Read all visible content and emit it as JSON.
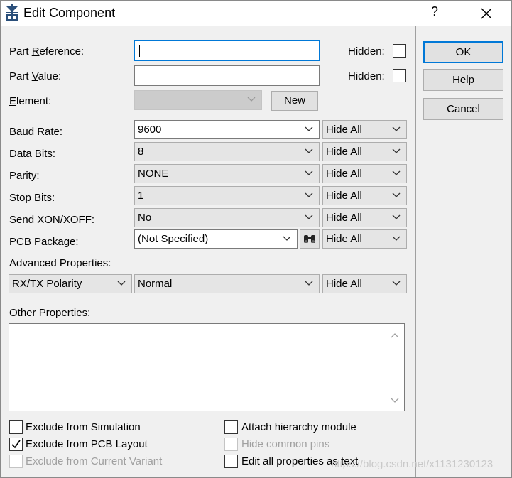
{
  "window": {
    "title": "Edit Component",
    "help_glyph": "?"
  },
  "fields": {
    "part_reference": {
      "label_pre": "Part ",
      "label_u": "R",
      "label_post": "eference:",
      "value": "",
      "hidden_label": "Hidden:"
    },
    "part_value": {
      "label_pre": "Part ",
      "label_u": "V",
      "label_post": "alue:",
      "value": "",
      "hidden_label": "Hidden:"
    },
    "element": {
      "label_u": "E",
      "label_post": "lement:",
      "value": "",
      "new_label": "New"
    }
  },
  "properties": [
    {
      "label": "Baud Rate:",
      "value": "9600",
      "hide": "Hide All"
    },
    {
      "label": "Data Bits:",
      "value": "8",
      "hide": "Hide All"
    },
    {
      "label": "Parity:",
      "value": "NONE",
      "hide": "Hide All"
    },
    {
      "label": "Stop Bits:",
      "value": "1",
      "hide": "Hide All"
    },
    {
      "label": "Send XON/XOFF:",
      "value": "No",
      "hide": "Hide All"
    },
    {
      "label": "PCB Package:",
      "value": "(Not Specified)",
      "hide": "Hide All"
    }
  ],
  "advanced": {
    "label": "Advanced Properties:",
    "name": "RX/TX Polarity",
    "value": "Normal",
    "hide": "Hide All"
  },
  "other": {
    "label_pre": "Other ",
    "label_u": "P",
    "label_post": "roperties:",
    "text": ""
  },
  "options": {
    "exclude_sim": {
      "label": "Exclude from Simulation",
      "checked": false,
      "enabled": true
    },
    "exclude_pcb": {
      "label": "Exclude from PCB Layout",
      "checked": true,
      "enabled": true
    },
    "exclude_variant": {
      "label": "Exclude from Current Variant",
      "checked": false,
      "enabled": false
    },
    "attach_hier": {
      "label": "Attach hierarchy module",
      "checked": false,
      "enabled": true
    },
    "hide_pins": {
      "label": "Hide common pins",
      "checked": false,
      "enabled": false
    },
    "edit_all_text": {
      "label": "Edit all properties as text",
      "checked": false,
      "enabled": true
    }
  },
  "buttons": {
    "ok": "OK",
    "help": "Help",
    "cancel": "Cancel"
  },
  "watermark": "https://blog.csdn.net/x1131230123",
  "colors": {
    "focus": "#0078d7",
    "disabled": "#a0a0a0"
  },
  "icons": [
    "component-app-icon",
    "close-icon",
    "chevron-down-icon",
    "binoculars-icon",
    "checkmark-icon",
    "scroll-up-icon",
    "scroll-down-icon"
  ]
}
